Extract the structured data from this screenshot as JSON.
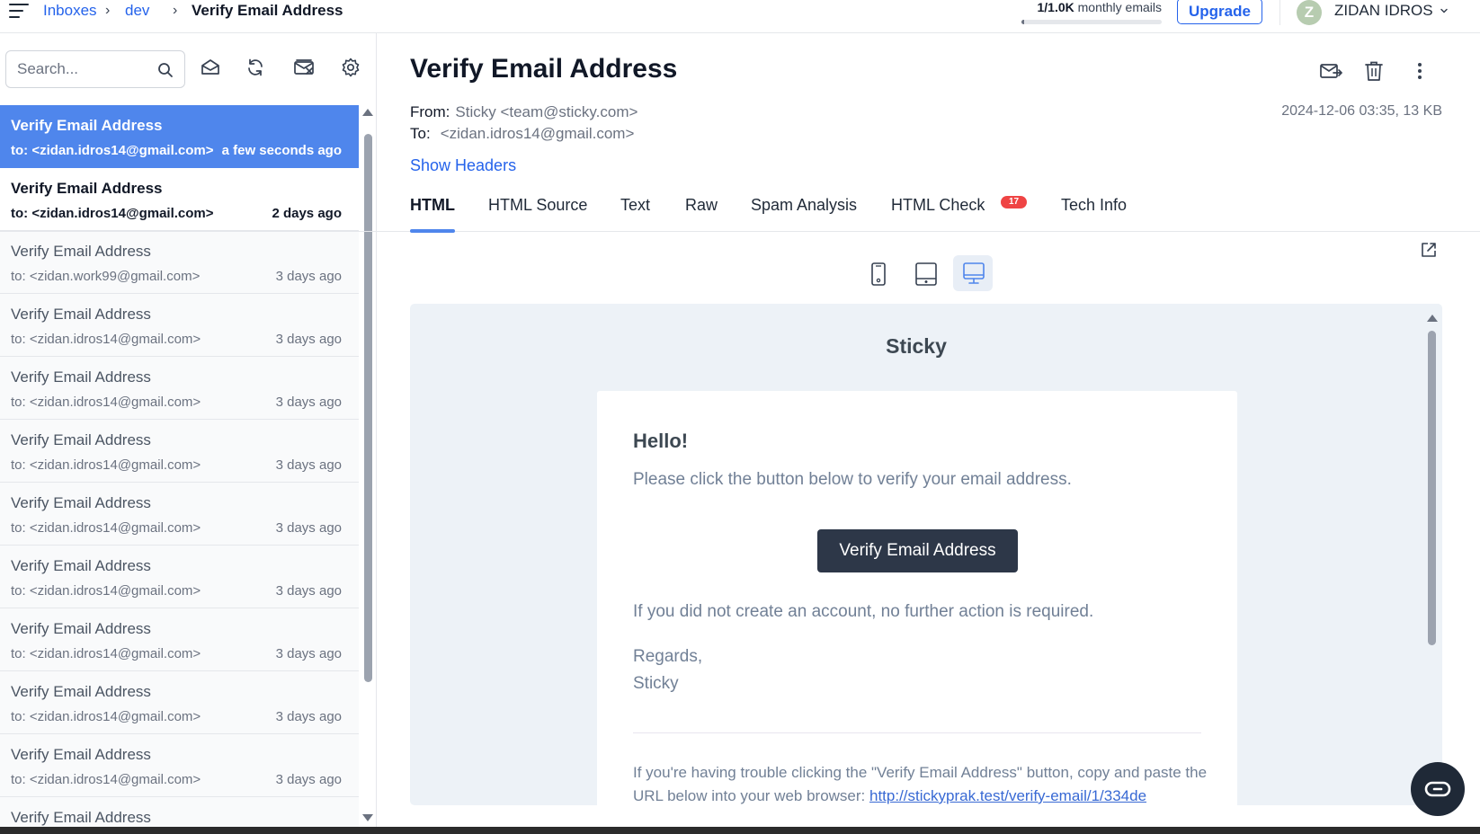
{
  "breadcrumb": {
    "inboxes": "Inboxes",
    "sep1": "›",
    "inbox": "dev",
    "sep2": "›",
    "current": "Verify Email Address"
  },
  "usage": {
    "count": "1/1.0K",
    "label": "monthly emails",
    "fraction": 0.001
  },
  "upgrade_label": "Upgrade",
  "user": {
    "initial": "Z",
    "name": "ZIDAN IDROS"
  },
  "search": {
    "placeholder": "Search..."
  },
  "toolbar_icons": [
    "search-icon",
    "mark-read-icon",
    "refresh-icon",
    "delete-all-icon",
    "settings-icon"
  ],
  "emails": [
    {
      "subject": "Verify Email Address",
      "to": "to: <zidan.idros14@gmail.com>",
      "time": "a few seconds ago",
      "state": "active"
    },
    {
      "subject": "Verify Email Address",
      "to": "to: <zidan.idros14@gmail.com>",
      "time": "2 days ago",
      "state": "unread"
    },
    {
      "subject": "Verify Email Address",
      "to": "to: <zidan.work99@gmail.com>",
      "time": "3 days ago",
      "state": "read"
    },
    {
      "subject": "Verify Email Address",
      "to": "to: <zidan.idros14@gmail.com>",
      "time": "3 days ago",
      "state": "read"
    },
    {
      "subject": "Verify Email Address",
      "to": "to: <zidan.idros14@gmail.com>",
      "time": "3 days ago",
      "state": "read"
    },
    {
      "subject": "Verify Email Address",
      "to": "to: <zidan.idros14@gmail.com>",
      "time": "3 days ago",
      "state": "read"
    },
    {
      "subject": "Verify Email Address",
      "to": "to: <zidan.idros14@gmail.com>",
      "time": "3 days ago",
      "state": "read"
    },
    {
      "subject": "Verify Email Address",
      "to": "to: <zidan.idros14@gmail.com>",
      "time": "3 days ago",
      "state": "read"
    },
    {
      "subject": "Verify Email Address",
      "to": "to: <zidan.idros14@gmail.com>",
      "time": "3 days ago",
      "state": "read"
    },
    {
      "subject": "Verify Email Address",
      "to": "to: <zidan.idros14@gmail.com>",
      "time": "3 days ago",
      "state": "read"
    },
    {
      "subject": "Verify Email Address",
      "to": "to: <zidan.idros14@gmail.com>",
      "time": "3 days ago",
      "state": "read"
    },
    {
      "subject": "Verify Email Address",
      "to": "",
      "time": "",
      "state": "read"
    }
  ],
  "message": {
    "title": "Verify Email Address",
    "from_label": "From:",
    "from_value": "Sticky <team@sticky.com>",
    "to_label": "To:",
    "to_value": "<zidan.idros14@gmail.com>",
    "date_size": "2024-12-06 03:35, 13 KB",
    "show_headers": "Show Headers",
    "actions": [
      "forward-icon",
      "trash-icon",
      "more-icon"
    ]
  },
  "tabs": [
    {
      "label": "HTML",
      "active": true
    },
    {
      "label": "HTML Source",
      "active": false
    },
    {
      "label": "Text",
      "active": false
    },
    {
      "label": "Raw",
      "active": false
    },
    {
      "label": "Spam Analysis",
      "active": false
    },
    {
      "label": "HTML Check",
      "active": false,
      "badge": "17"
    },
    {
      "label": "Tech Info",
      "active": false
    }
  ],
  "devices": [
    {
      "name": "mobile-view-icon",
      "selected": false
    },
    {
      "name": "tablet-view-icon",
      "selected": false
    },
    {
      "name": "desktop-view-icon",
      "selected": true
    }
  ],
  "email_body": {
    "brand": "Sticky",
    "greeting": "Hello!",
    "intro": "Please click the button below to verify your email address.",
    "button": "Verify Email Address",
    "outro": "If you did not create an account, no further action is required.",
    "regards": "Regards,",
    "signature": "Sticky",
    "trouble_line": "If you're having trouble clicking the \"Verify Email Address\" button, copy and paste the URL below into your web browser: ",
    "link": "http://stickyprak.test/verify-email/1/334de"
  },
  "colors": {
    "accent": "#4f86ec",
    "link": "#2563eb",
    "badge": "#ef4444",
    "preview_bg": "#edf2f7",
    "email_button": "#2d3748"
  }
}
